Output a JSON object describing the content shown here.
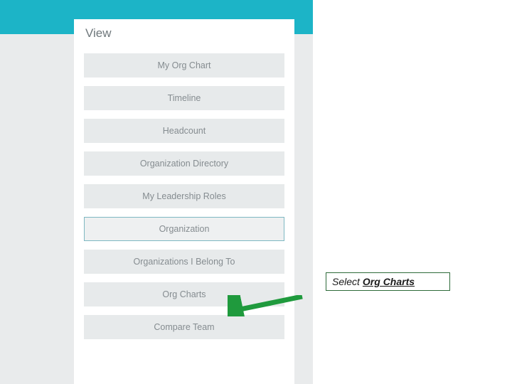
{
  "panel": {
    "title": "View",
    "items": [
      {
        "label": "My Org Chart",
        "highlight": false
      },
      {
        "label": "Timeline",
        "highlight": false
      },
      {
        "label": "Headcount",
        "highlight": false
      },
      {
        "label": "Organization Directory",
        "highlight": false
      },
      {
        "label": "My Leadership Roles",
        "highlight": false
      },
      {
        "label": "Organization",
        "highlight": true
      },
      {
        "label": "Organizations I Belong To",
        "highlight": false
      },
      {
        "label": "Org Charts",
        "highlight": false
      },
      {
        "label": "Compare Team",
        "highlight": false
      }
    ]
  },
  "callout": {
    "prefix": "Select",
    "target": "Org Charts"
  },
  "colors": {
    "teal": "#1cb4c7",
    "arrow": "#1f9a3d"
  }
}
